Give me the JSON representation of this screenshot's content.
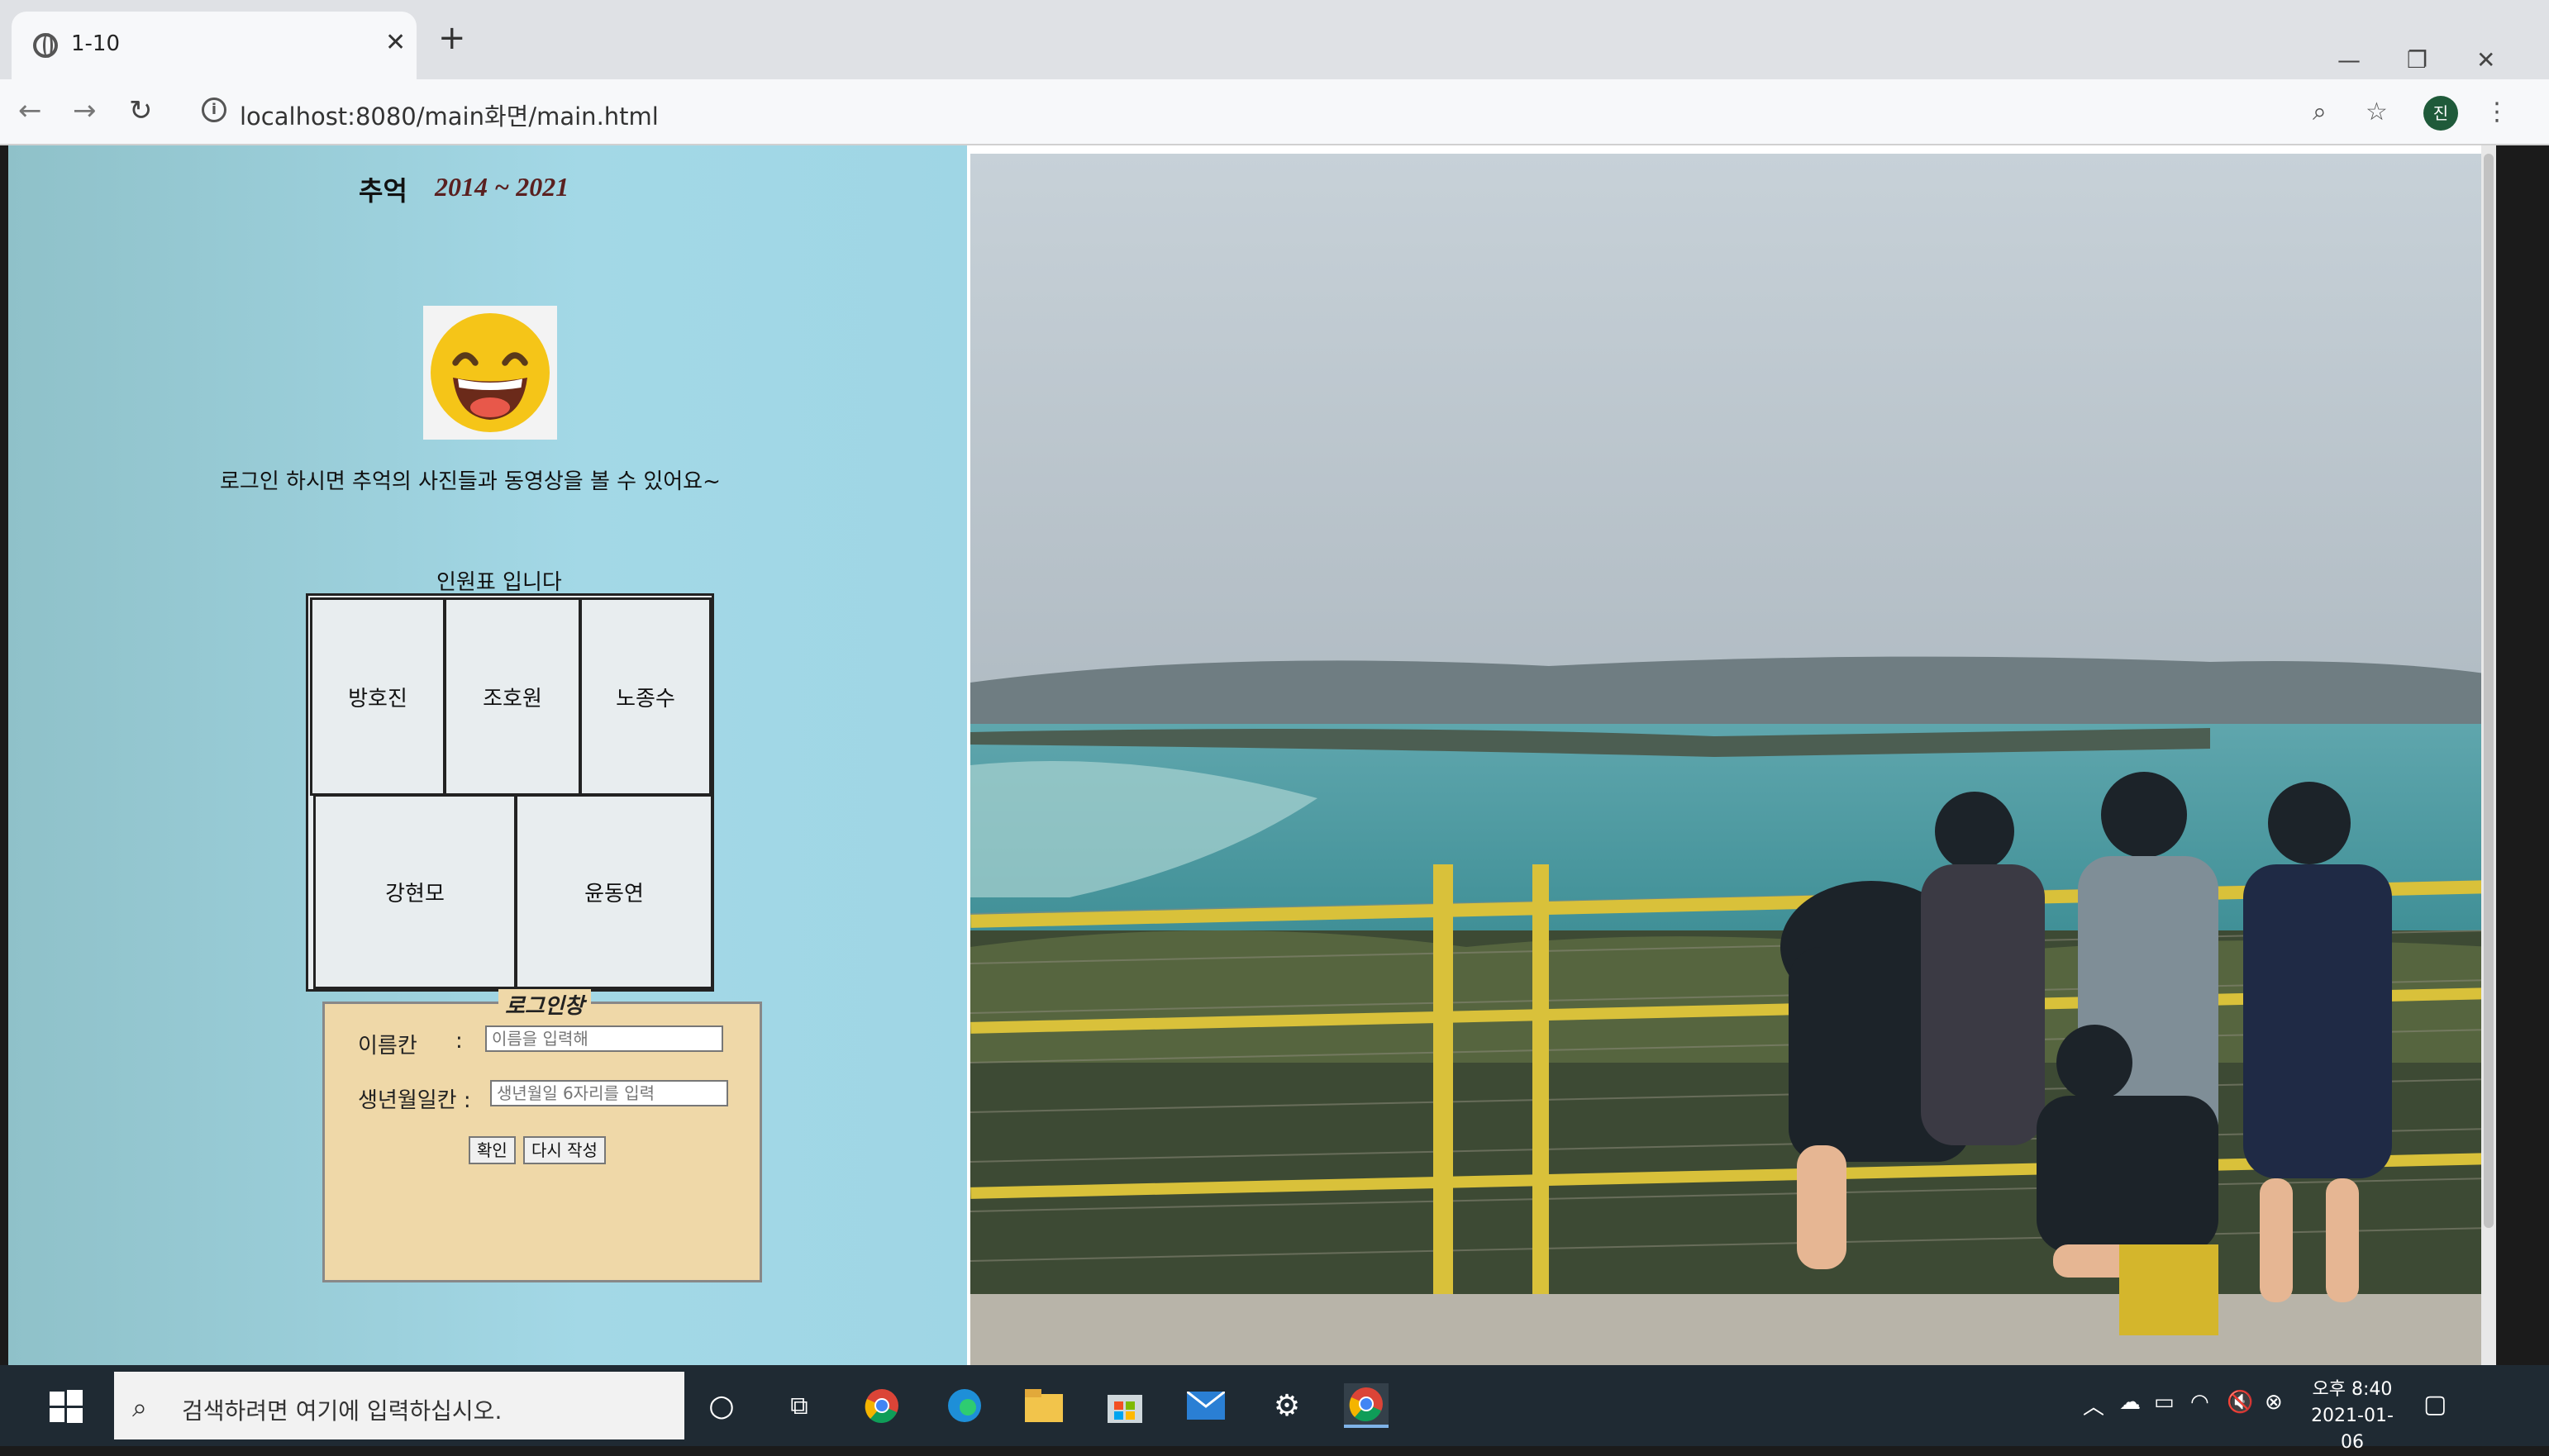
{
  "browser": {
    "tab_title": "1-10",
    "new_tab_symbol": "+",
    "url": "localhost:8080/main화면/main.html",
    "profile_initial": "진"
  },
  "page": {
    "heading": "추억",
    "years": "2014 ~ 2021",
    "intro_text": "로그인 하시면 추억의 사진들과 동영상을 볼 수 있어요~",
    "roster_caption": "인원표 입니다",
    "roster": [
      "방호진",
      "조호원",
      "노종수",
      "강현모",
      "윤동연"
    ],
    "login": {
      "legend": "로그인창",
      "name_label": "이름칸",
      "name_colon": ":",
      "name_placeholder": "이름을 입력해",
      "birth_label": "생년월일칸 :",
      "birth_placeholder": "생년월일 6자리를 입력",
      "confirm_label": "확인",
      "reset_label": "다시 작성"
    }
  },
  "taskbar": {
    "search_placeholder": "검색하려면 여기에 입력하십시오.",
    "time": "오후 8:40",
    "date": "2021-01-06"
  },
  "colors": {
    "left_panel": "#a3d8e6",
    "login_box": "#efd8a8",
    "years_text": "#5a2020",
    "taskbar": "#1f2a33"
  }
}
